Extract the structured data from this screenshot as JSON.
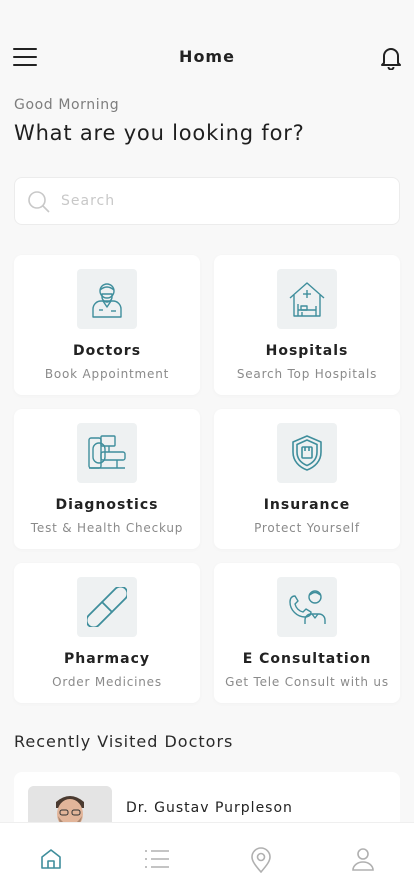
{
  "header": {
    "title": "Home"
  },
  "greeting": "Good Morning",
  "heading": "What are you looking for?",
  "search": {
    "placeholder": "Search",
    "value": ""
  },
  "categories": [
    {
      "title": "Doctors",
      "subtitle": "Book Appointment",
      "icon": "doctor-icon"
    },
    {
      "title": "Hospitals",
      "subtitle": "Search Top Hospitals",
      "icon": "hospital-icon"
    },
    {
      "title": "Diagnostics",
      "subtitle": "Test & Health Checkup",
      "icon": "diagnostics-icon"
    },
    {
      "title": "Insurance",
      "subtitle": "Protect Yourself",
      "icon": "shield-icon"
    },
    {
      "title": "Pharmacy",
      "subtitle": "Order Medicines",
      "icon": "pill-icon"
    },
    {
      "title": "E Consultation",
      "subtitle": "Get Tele Consult with us",
      "icon": "tele-consult-icon"
    }
  ],
  "recent": {
    "title": "Recently Visited Doctors",
    "doctors": [
      {
        "name": "Dr. Gustav Purpleson"
      }
    ]
  },
  "tabbar": [
    {
      "name": "home-icon",
      "active": true
    },
    {
      "name": "list-icon",
      "active": false
    },
    {
      "name": "location-pin-icon",
      "active": false
    },
    {
      "name": "profile-icon",
      "active": false
    }
  ],
  "colors": {
    "accent": "#3f8e9c",
    "background": "#f8f8f8",
    "icon_tile": "#eef1f2"
  }
}
